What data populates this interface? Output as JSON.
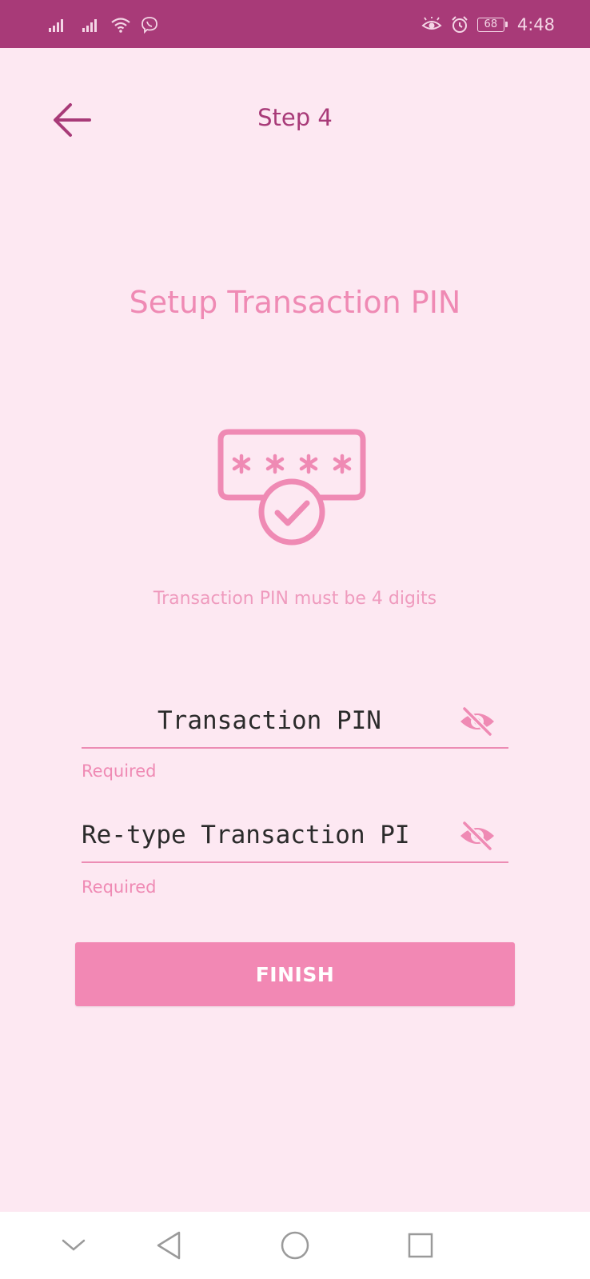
{
  "status_bar": {
    "icons": [
      "signal-icon",
      "signal-icon",
      "wifi-icon",
      "viber-icon",
      "eye-icon",
      "alarm-icon"
    ],
    "battery": "68",
    "time": "4:48"
  },
  "header": {
    "title": "Step 4"
  },
  "main": {
    "heading": "Setup Transaction PIN",
    "illustration_icon": "pin-check-icon",
    "hint": "Transaction PIN must be 4 digits",
    "pin_field": {
      "placeholder": "Transaction PIN",
      "value": "",
      "error": "Required"
    },
    "retype_field": {
      "placeholder": "Re-type Transaction PI",
      "value": "",
      "error": "Required"
    },
    "finish_label": "FINISH"
  },
  "colors": {
    "status_bar": "#a83a78",
    "background": "#fde8f2",
    "accent": "#f288b4",
    "title": "#a83a78"
  },
  "nav_bar": {
    "icons": [
      "chevron-down-icon",
      "back-triangle-icon",
      "home-circle-icon",
      "recents-square-icon"
    ]
  }
}
